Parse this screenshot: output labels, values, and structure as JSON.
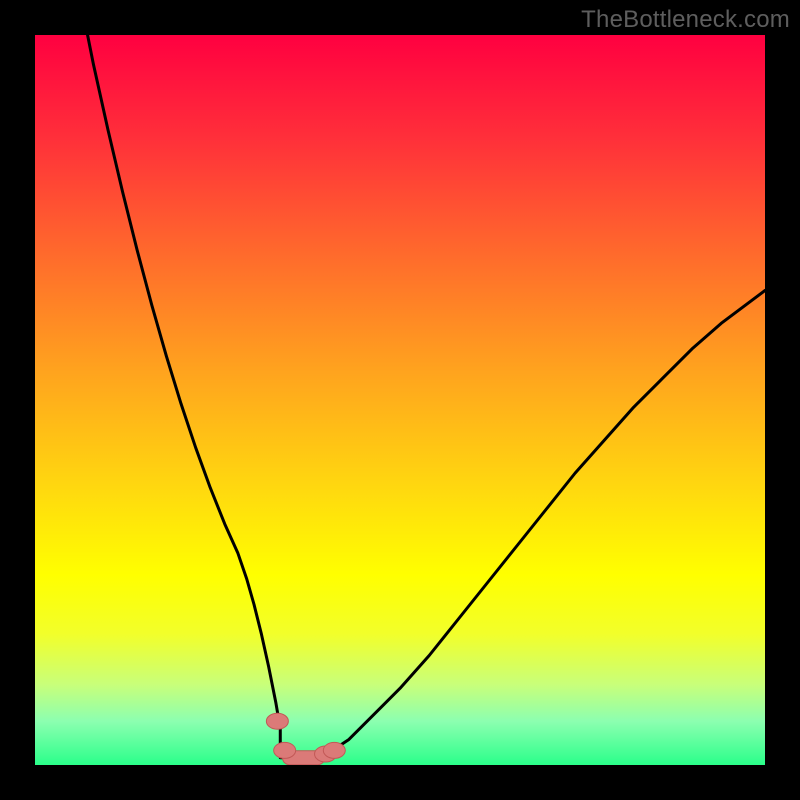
{
  "watermark": "TheBottleneck.com",
  "colors": {
    "frame": "#000000",
    "curve_stroke": "#000000",
    "marker_fill": "#db7a78",
    "marker_stroke": "#c25856",
    "gradient_stops": [
      {
        "offset": "0%",
        "color": "#ff0040"
      },
      {
        "offset": "14%",
        "color": "#ff2f3a"
      },
      {
        "offset": "30%",
        "color": "#ff6a2c"
      },
      {
        "offset": "46%",
        "color": "#ffa31e"
      },
      {
        "offset": "62%",
        "color": "#ffd80f"
      },
      {
        "offset": "74%",
        "color": "#ffff00"
      },
      {
        "offset": "82%",
        "color": "#f2ff2a"
      },
      {
        "offset": "89%",
        "color": "#c8ff7a"
      },
      {
        "offset": "94%",
        "color": "#8cffb0"
      },
      {
        "offset": "100%",
        "color": "#2aff8a"
      }
    ]
  },
  "chart_data": {
    "type": "line",
    "title": "",
    "xlabel": "",
    "ylabel": "",
    "x_range": [
      0,
      100
    ],
    "y_range": [
      0,
      100
    ],
    "x": [
      0,
      2,
      4,
      6,
      8,
      10,
      12,
      14,
      16,
      18,
      20,
      22,
      24,
      26,
      27.8,
      29,
      30,
      31,
      32,
      33,
      33.6,
      34,
      35,
      36,
      37,
      38,
      40,
      43,
      46,
      50,
      54,
      58,
      62,
      66,
      70,
      74,
      78,
      82,
      86,
      90,
      94,
      98,
      100
    ],
    "values": [
      138,
      127,
      116,
      106,
      96,
      87,
      78.5,
      70.5,
      63,
      56,
      49.5,
      43.5,
      38,
      33,
      29,
      25.5,
      22,
      18,
      13.5,
      8.5,
      5,
      3,
      1.5,
      1,
      1,
      1,
      1.5,
      3.5,
      6.5,
      10.5,
      15,
      20,
      25,
      30,
      35,
      40,
      44.5,
      49,
      53,
      57,
      60.5,
      63.5,
      65
    ],
    "optimum_band_x": [
      33.6,
      40
    ],
    "markers": [
      {
        "x": 33.2,
        "y": 6
      },
      {
        "x": 34.2,
        "y": 2
      },
      {
        "x": 39.8,
        "y": 1.5
      },
      {
        "x": 41.0,
        "y": 2.0
      }
    ],
    "flat_band_y": 1
  }
}
